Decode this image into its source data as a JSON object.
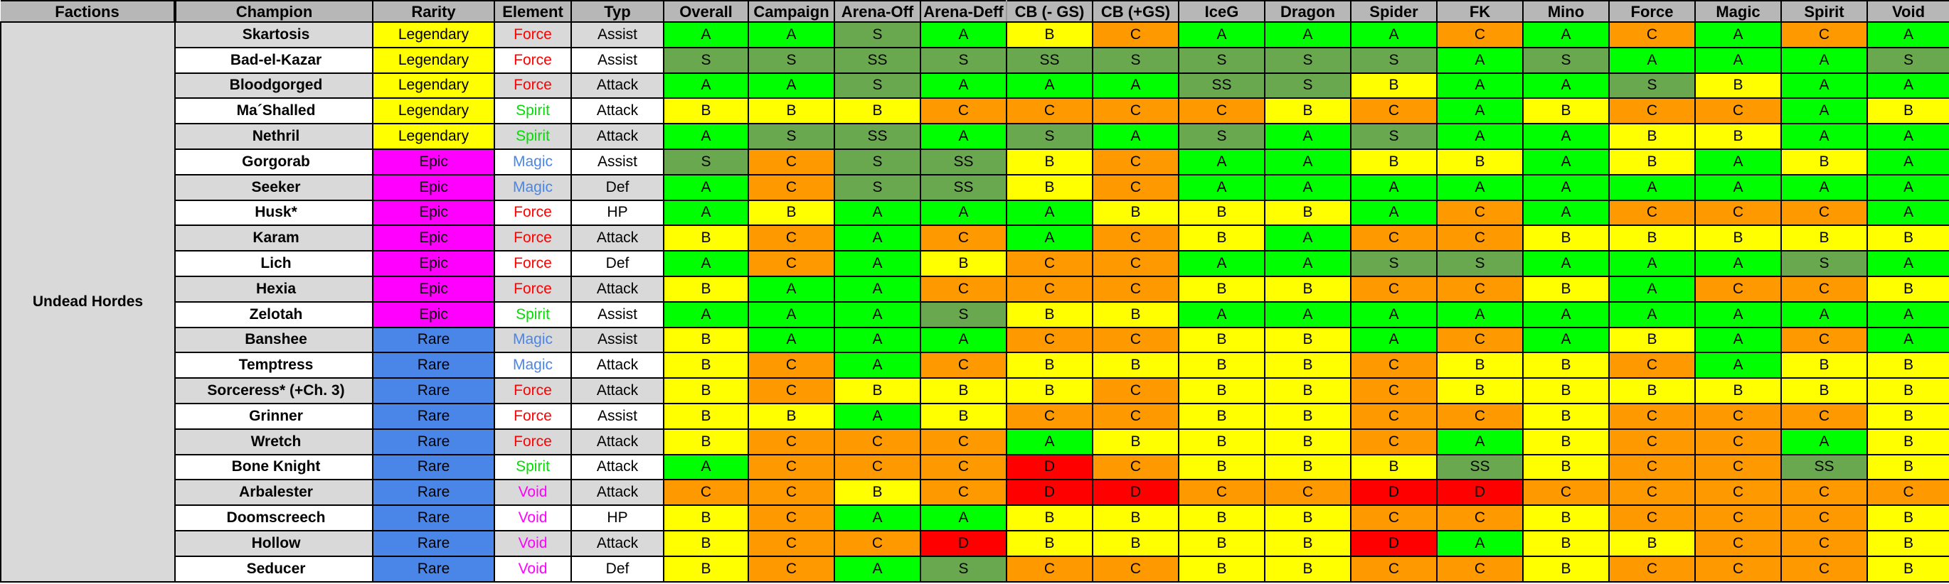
{
  "headers": {
    "factions": "Factions",
    "champion": "Champion",
    "rarity": "Rarity",
    "element": "Element",
    "typ": "Typ",
    "grades": [
      "Overall",
      "Campaign",
      "Arena-Off",
      "Arena-Deff",
      "CB (- GS)",
      "CB (+GS)",
      "IceG",
      "Dragon",
      "Spider",
      "FK",
      "Mino",
      "Force",
      "Magic",
      "Spirit",
      "Void"
    ]
  },
  "faction": "Undead Hordes",
  "colors": {
    "header_bg": "#b7b7b7",
    "row_alt_bg": "#d9d9d9",
    "grade_SS": "#6aa84f",
    "grade_S": "#6aa84f",
    "grade_A": "#00ff00",
    "grade_B": "#ffff00",
    "grade_C": "#ff9900",
    "grade_D": "#ff0000",
    "rarity_legendary": "#ffff00",
    "rarity_epic": "#ff00ff",
    "rarity_rare": "#4a86e8",
    "element_force": "#ff0000",
    "element_spirit": "#00dd00",
    "element_magic": "#4a86e8",
    "element_void": "#ff00ff"
  },
  "rows": [
    {
      "champion": "Skartosis",
      "rarity": "Legendary",
      "element": "Force",
      "typ": "Assist",
      "grades": [
        "A",
        "A",
        "S",
        "A",
        "B",
        "C",
        "A",
        "A",
        "A",
        "C",
        "A",
        "C",
        "A",
        "C",
        "A"
      ]
    },
    {
      "champion": "Bad-el-Kazar",
      "rarity": "Legendary",
      "element": "Force",
      "typ": "Assist",
      "grades": [
        "S",
        "S",
        "SS",
        "S",
        "SS",
        "S",
        "S",
        "S",
        "S",
        "A",
        "S",
        "A",
        "A",
        "A",
        "S"
      ]
    },
    {
      "champion": "Bloodgorged",
      "rarity": "Legendary",
      "element": "Force",
      "typ": "Attack",
      "grades": [
        "A",
        "A",
        "S",
        "A",
        "A",
        "A",
        "SS",
        "S",
        "B",
        "A",
        "A",
        "S",
        "B",
        "A",
        "A"
      ]
    },
    {
      "champion": "Ma´Shalled",
      "rarity": "Legendary",
      "element": "Spirit",
      "typ": "Attack",
      "grades": [
        "B",
        "B",
        "B",
        "C",
        "C",
        "C",
        "C",
        "B",
        "C",
        "A",
        "B",
        "C",
        "C",
        "A",
        "B"
      ]
    },
    {
      "champion": "Nethril",
      "rarity": "Legendary",
      "element": "Spirit",
      "typ": "Attack",
      "grades": [
        "A",
        "S",
        "SS",
        "A",
        "S",
        "A",
        "S",
        "A",
        "S",
        "A",
        "A",
        "B",
        "B",
        "A",
        "A"
      ]
    },
    {
      "champion": "Gorgorab",
      "rarity": "Epic",
      "element": "Magic",
      "typ": "Assist",
      "grades": [
        "S",
        "C",
        "S",
        "SS",
        "B",
        "C",
        "A",
        "A",
        "B",
        "B",
        "A",
        "B",
        "A",
        "B",
        "A"
      ]
    },
    {
      "champion": "Seeker",
      "rarity": "Epic",
      "element": "Magic",
      "typ": "Def",
      "grades": [
        "A",
        "C",
        "S",
        "SS",
        "B",
        "C",
        "A",
        "A",
        "A",
        "A",
        "A",
        "A",
        "A",
        "A",
        "A"
      ]
    },
    {
      "champion": "Husk*",
      "rarity": "Epic",
      "element": "Force",
      "typ": "HP",
      "grades": [
        "A",
        "B",
        "A",
        "A",
        "A",
        "B",
        "B",
        "B",
        "A",
        "C",
        "A",
        "C",
        "C",
        "C",
        "A"
      ]
    },
    {
      "champion": "Karam",
      "rarity": "Epic",
      "element": "Force",
      "typ": "Attack",
      "grades": [
        "B",
        "C",
        "A",
        "C",
        "A",
        "C",
        "B",
        "A",
        "C",
        "C",
        "B",
        "B",
        "B",
        "B",
        "B"
      ]
    },
    {
      "champion": "Lich",
      "rarity": "Epic",
      "element": "Force",
      "typ": "Def",
      "grades": [
        "A",
        "C",
        "A",
        "B",
        "C",
        "C",
        "A",
        "A",
        "S",
        "S",
        "A",
        "A",
        "A",
        "S",
        "A"
      ]
    },
    {
      "champion": "Hexia",
      "rarity": "Epic",
      "element": "Force",
      "typ": "Attack",
      "grades": [
        "B",
        "A",
        "A",
        "C",
        "C",
        "C",
        "B",
        "B",
        "C",
        "C",
        "B",
        "A",
        "C",
        "C",
        "B"
      ]
    },
    {
      "champion": "Zelotah",
      "rarity": "Epic",
      "element": "Spirit",
      "typ": "Assist",
      "grades": [
        "A",
        "A",
        "A",
        "S",
        "B",
        "B",
        "A",
        "A",
        "A",
        "A",
        "A",
        "A",
        "A",
        "A",
        "A"
      ]
    },
    {
      "champion": "Banshee",
      "rarity": "Rare",
      "element": "Magic",
      "typ": "Assist",
      "grades": [
        "B",
        "A",
        "A",
        "A",
        "C",
        "C",
        "B",
        "B",
        "A",
        "C",
        "A",
        "B",
        "A",
        "C",
        "A"
      ]
    },
    {
      "champion": "Temptress",
      "rarity": "Rare",
      "element": "Magic",
      "typ": "Attack",
      "grades": [
        "B",
        "C",
        "A",
        "C",
        "B",
        "B",
        "B",
        "B",
        "C",
        "B",
        "B",
        "C",
        "A",
        "B",
        "B"
      ]
    },
    {
      "champion": "Sorceress* (+Ch. 3)",
      "rarity": "Rare",
      "element": "Force",
      "typ": "Attack",
      "grades": [
        "B",
        "C",
        "B",
        "B",
        "B",
        "C",
        "B",
        "B",
        "C",
        "B",
        "B",
        "B",
        "B",
        "B",
        "B"
      ]
    },
    {
      "champion": "Grinner",
      "rarity": "Rare",
      "element": "Force",
      "typ": "Assist",
      "grades": [
        "B",
        "B",
        "A",
        "B",
        "C",
        "C",
        "B",
        "B",
        "C",
        "C",
        "B",
        "C",
        "C",
        "C",
        "B"
      ]
    },
    {
      "champion": "Wretch",
      "rarity": "Rare",
      "element": "Force",
      "typ": "Attack",
      "grades": [
        "B",
        "C",
        "C",
        "C",
        "A",
        "B",
        "B",
        "B",
        "C",
        "A",
        "B",
        "C",
        "C",
        "A",
        "B"
      ]
    },
    {
      "champion": "Bone Knight",
      "rarity": "Rare",
      "element": "Spirit",
      "typ": "Attack",
      "grades": [
        "A",
        "C",
        "C",
        "C",
        "D",
        "C",
        "B",
        "B",
        "B",
        "SS",
        "B",
        "C",
        "C",
        "SS",
        "B"
      ]
    },
    {
      "champion": "Arbalester",
      "rarity": "Rare",
      "element": "Void",
      "typ": "Attack",
      "grades": [
        "C",
        "C",
        "B",
        "C",
        "D",
        "D",
        "C",
        "C",
        "D",
        "D",
        "C",
        "C",
        "C",
        "C",
        "C"
      ]
    },
    {
      "champion": "Doomscreech",
      "rarity": "Rare",
      "element": "Void",
      "typ": "HP",
      "grades": [
        "B",
        "C",
        "A",
        "A",
        "B",
        "B",
        "B",
        "B",
        "C",
        "C",
        "B",
        "C",
        "C",
        "C",
        "B"
      ]
    },
    {
      "champion": "Hollow",
      "rarity": "Rare",
      "element": "Void",
      "typ": "Attack",
      "grades": [
        "B",
        "C",
        "C",
        "D",
        "B",
        "B",
        "B",
        "B",
        "D",
        "A",
        "B",
        "B",
        "C",
        "C",
        "B"
      ]
    },
    {
      "champion": "Seducer",
      "rarity": "Rare",
      "element": "Void",
      "typ": "Def",
      "grades": [
        "B",
        "C",
        "A",
        "S",
        "C",
        "C",
        "B",
        "B",
        "C",
        "C",
        "B",
        "C",
        "C",
        "C",
        "B"
      ]
    }
  ]
}
